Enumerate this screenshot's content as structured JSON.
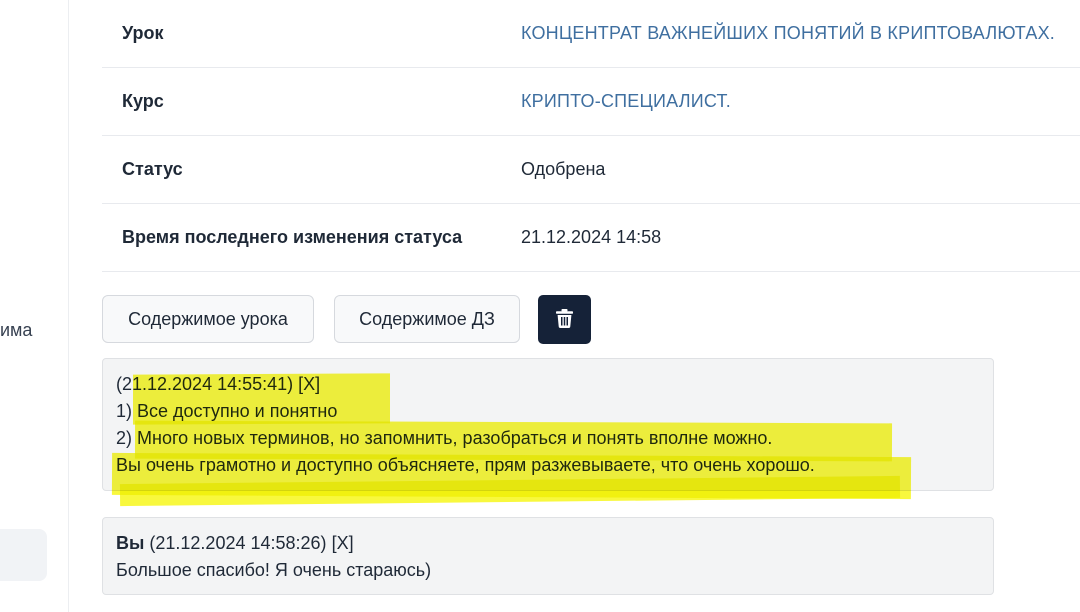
{
  "sidebar": {
    "partial_label": "има"
  },
  "info_table": {
    "rows": [
      {
        "label": "Урок",
        "value": "КОНЦЕНТРАТ ВАЖНЕЙШИХ ПОНЯТИЙ В КРИПТОВАЛЮТАХ."
      },
      {
        "label": "Курс",
        "value": "КРИПТО-СПЕЦИАЛИСТ."
      },
      {
        "label": "Статус",
        "value": "Одобрена"
      },
      {
        "label": "Время последнего изменения статуса",
        "value": "21.12.2024 14:58"
      }
    ]
  },
  "actions": {
    "lesson_content_label": "Содержимое урока",
    "homework_content_label": "Содержимое ДЗ",
    "delete_icon": "trash-icon",
    "delete_button_color": "#152238"
  },
  "comments": [
    {
      "author": "",
      "timestamp": "(21.12.2024 14:55:41)",
      "remove_label": "[X]",
      "lines": [
        "1) Все доступно и понятно",
        "2) Много новых терминов, но запомнить, разобраться и понять вполне можно.",
        "Вы очень грамотно и доступно объясняете, прям разжевываете, что очень хорошо."
      ]
    },
    {
      "author": "Вы",
      "timestamp": "(21.12.2024 14:58:26)",
      "remove_label": "[X]",
      "lines": [
        "Большое спасибо! Я очень стараюсь)"
      ]
    }
  ],
  "colors": {
    "link": "#3f6fa0",
    "highlight": "#f6f614",
    "comment_bg": "#f3f4f5"
  }
}
